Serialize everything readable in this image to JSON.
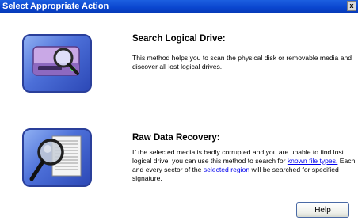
{
  "window": {
    "title": "Select Appropriate Action",
    "close_glyph": "x"
  },
  "options": [
    {
      "heading": "Search Logical Drive:",
      "description": "This method helps you to scan the physical disk or removable media and discover all lost logical drives.",
      "icon": "drive-search-icon"
    },
    {
      "heading": "Raw Data Recovery:",
      "desc_part1": "If the selected media is badly corrupted and you are unable to find lost logical drive, you can use this method to search for ",
      "link1": "known file types.",
      "desc_part2": " Each and every sector of the ",
      "link2": "selected region",
      "desc_part3": " will be searched for specified signature.",
      "icon": "raw-data-magnifier-icon"
    }
  ],
  "footer": {
    "help_label": "Help"
  },
  "colors": {
    "titlebar": "#0a46cf",
    "link": "#0000ee",
    "tile": "#4c6fd8"
  }
}
